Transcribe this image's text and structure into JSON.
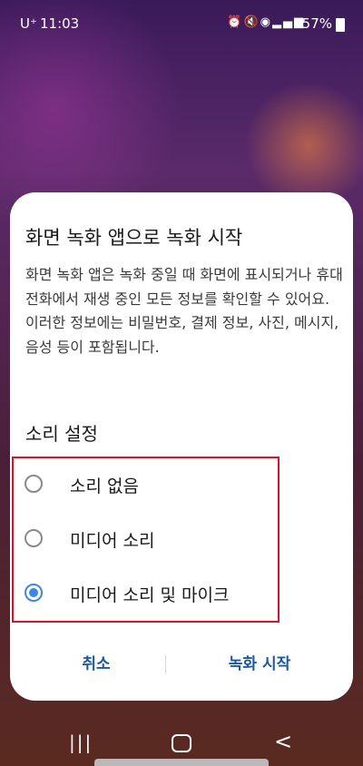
{
  "status_bar": {
    "carrier": "U⁺",
    "time": "11:03",
    "battery_percent": "57%",
    "icons": [
      "alarm-icon",
      "mute-icon",
      "wifi-icon",
      "signal-icon",
      "battery-icon"
    ]
  },
  "dialog": {
    "title": "화면 녹화 앱으로 녹화 시작",
    "message": "화면 녹화 앱은 녹화 중일 때 화면에 표시되거나 휴대전화에서 재생 중인 모든 정보를 확인할 수 있어요. 이러한 정보에는 비밀번호, 결제 정보, 사진, 메시지, 음성 등이 포함됩니다.",
    "sound_section_title": "소리 설정",
    "sound_options": [
      {
        "label": "소리 없음",
        "selected": false
      },
      {
        "label": "미디어 소리",
        "selected": false
      },
      {
        "label": "미디어 소리 및 마이크",
        "selected": true
      }
    ],
    "cancel_label": "취소",
    "start_label": "녹화 시작"
  },
  "nav_bar": {
    "recents_label": "|||",
    "back_label": "<"
  },
  "colors": {
    "accent": "#3d86e6",
    "button_text": "#1a5aa0",
    "highlight_border": "#d9122a"
  }
}
